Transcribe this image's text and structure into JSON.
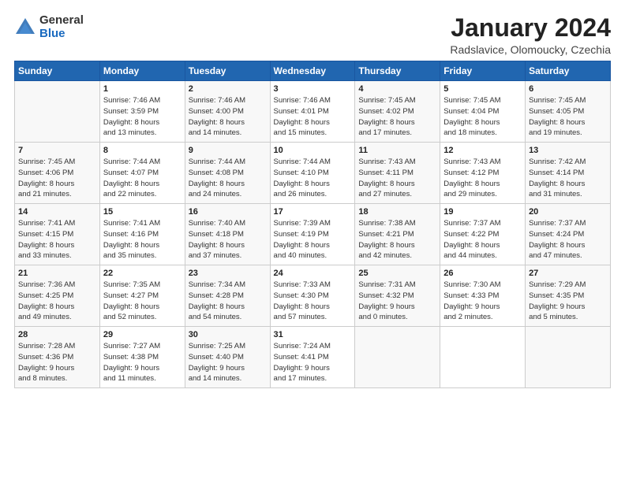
{
  "logo": {
    "general": "General",
    "blue": "Blue"
  },
  "title": "January 2024",
  "subtitle": "Radslavice, Olomoucky, Czechia",
  "days_header": [
    "Sunday",
    "Monday",
    "Tuesday",
    "Wednesday",
    "Thursday",
    "Friday",
    "Saturday"
  ],
  "weeks": [
    [
      {
        "day": "",
        "info": ""
      },
      {
        "day": "1",
        "info": "Sunrise: 7:46 AM\nSunset: 3:59 PM\nDaylight: 8 hours\nand 13 minutes."
      },
      {
        "day": "2",
        "info": "Sunrise: 7:46 AM\nSunset: 4:00 PM\nDaylight: 8 hours\nand 14 minutes."
      },
      {
        "day": "3",
        "info": "Sunrise: 7:46 AM\nSunset: 4:01 PM\nDaylight: 8 hours\nand 15 minutes."
      },
      {
        "day": "4",
        "info": "Sunrise: 7:45 AM\nSunset: 4:02 PM\nDaylight: 8 hours\nand 17 minutes."
      },
      {
        "day": "5",
        "info": "Sunrise: 7:45 AM\nSunset: 4:04 PM\nDaylight: 8 hours\nand 18 minutes."
      },
      {
        "day": "6",
        "info": "Sunrise: 7:45 AM\nSunset: 4:05 PM\nDaylight: 8 hours\nand 19 minutes."
      }
    ],
    [
      {
        "day": "7",
        "info": "Sunrise: 7:45 AM\nSunset: 4:06 PM\nDaylight: 8 hours\nand 21 minutes."
      },
      {
        "day": "8",
        "info": "Sunrise: 7:44 AM\nSunset: 4:07 PM\nDaylight: 8 hours\nand 22 minutes."
      },
      {
        "day": "9",
        "info": "Sunrise: 7:44 AM\nSunset: 4:08 PM\nDaylight: 8 hours\nand 24 minutes."
      },
      {
        "day": "10",
        "info": "Sunrise: 7:44 AM\nSunset: 4:10 PM\nDaylight: 8 hours\nand 26 minutes."
      },
      {
        "day": "11",
        "info": "Sunrise: 7:43 AM\nSunset: 4:11 PM\nDaylight: 8 hours\nand 27 minutes."
      },
      {
        "day": "12",
        "info": "Sunrise: 7:43 AM\nSunset: 4:12 PM\nDaylight: 8 hours\nand 29 minutes."
      },
      {
        "day": "13",
        "info": "Sunrise: 7:42 AM\nSunset: 4:14 PM\nDaylight: 8 hours\nand 31 minutes."
      }
    ],
    [
      {
        "day": "14",
        "info": "Sunrise: 7:41 AM\nSunset: 4:15 PM\nDaylight: 8 hours\nand 33 minutes."
      },
      {
        "day": "15",
        "info": "Sunrise: 7:41 AM\nSunset: 4:16 PM\nDaylight: 8 hours\nand 35 minutes."
      },
      {
        "day": "16",
        "info": "Sunrise: 7:40 AM\nSunset: 4:18 PM\nDaylight: 8 hours\nand 37 minutes."
      },
      {
        "day": "17",
        "info": "Sunrise: 7:39 AM\nSunset: 4:19 PM\nDaylight: 8 hours\nand 40 minutes."
      },
      {
        "day": "18",
        "info": "Sunrise: 7:38 AM\nSunset: 4:21 PM\nDaylight: 8 hours\nand 42 minutes."
      },
      {
        "day": "19",
        "info": "Sunrise: 7:37 AM\nSunset: 4:22 PM\nDaylight: 8 hours\nand 44 minutes."
      },
      {
        "day": "20",
        "info": "Sunrise: 7:37 AM\nSunset: 4:24 PM\nDaylight: 8 hours\nand 47 minutes."
      }
    ],
    [
      {
        "day": "21",
        "info": "Sunrise: 7:36 AM\nSunset: 4:25 PM\nDaylight: 8 hours\nand 49 minutes."
      },
      {
        "day": "22",
        "info": "Sunrise: 7:35 AM\nSunset: 4:27 PM\nDaylight: 8 hours\nand 52 minutes."
      },
      {
        "day": "23",
        "info": "Sunrise: 7:34 AM\nSunset: 4:28 PM\nDaylight: 8 hours\nand 54 minutes."
      },
      {
        "day": "24",
        "info": "Sunrise: 7:33 AM\nSunset: 4:30 PM\nDaylight: 8 hours\nand 57 minutes."
      },
      {
        "day": "25",
        "info": "Sunrise: 7:31 AM\nSunset: 4:32 PM\nDaylight: 9 hours\nand 0 minutes."
      },
      {
        "day": "26",
        "info": "Sunrise: 7:30 AM\nSunset: 4:33 PM\nDaylight: 9 hours\nand 2 minutes."
      },
      {
        "day": "27",
        "info": "Sunrise: 7:29 AM\nSunset: 4:35 PM\nDaylight: 9 hours\nand 5 minutes."
      }
    ],
    [
      {
        "day": "28",
        "info": "Sunrise: 7:28 AM\nSunset: 4:36 PM\nDaylight: 9 hours\nand 8 minutes."
      },
      {
        "day": "29",
        "info": "Sunrise: 7:27 AM\nSunset: 4:38 PM\nDaylight: 9 hours\nand 11 minutes."
      },
      {
        "day": "30",
        "info": "Sunrise: 7:25 AM\nSunset: 4:40 PM\nDaylight: 9 hours\nand 14 minutes."
      },
      {
        "day": "31",
        "info": "Sunrise: 7:24 AM\nSunset: 4:41 PM\nDaylight: 9 hours\nand 17 minutes."
      },
      {
        "day": "",
        "info": ""
      },
      {
        "day": "",
        "info": ""
      },
      {
        "day": "",
        "info": ""
      }
    ]
  ]
}
